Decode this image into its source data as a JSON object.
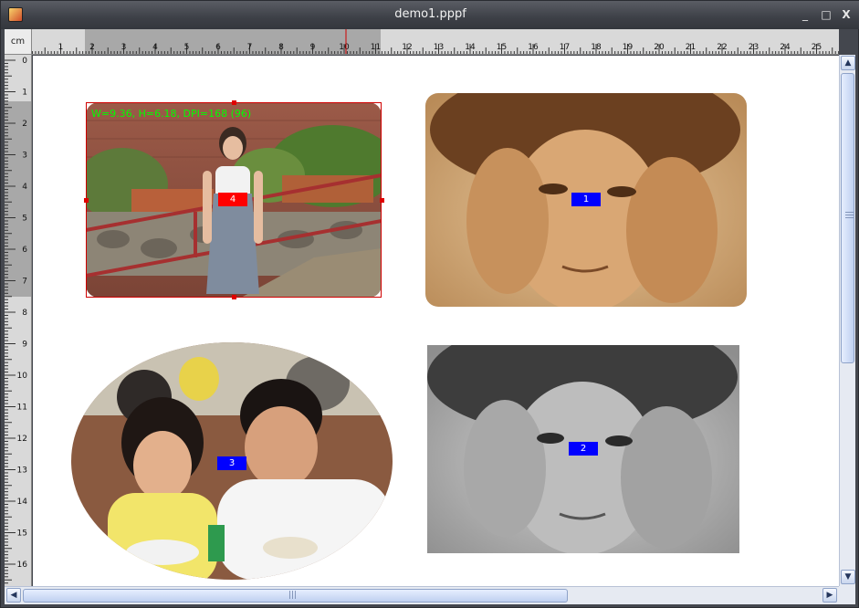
{
  "window": {
    "title": "demo1.pppf",
    "buttons": {
      "minimize": "_",
      "maximize": "□",
      "close": "X"
    }
  },
  "ruler": {
    "unit": "cm",
    "horizontal_labels": [
      "1",
      "2",
      "3",
      "4",
      "5",
      "6",
      "7",
      "8",
      "9",
      "10",
      "11",
      "12",
      "13",
      "14",
      "15",
      "16",
      "17",
      "18",
      "19",
      "20",
      "21",
      "22",
      "23",
      "24",
      "25"
    ],
    "vertical_labels": [
      "0",
      "1",
      "2",
      "3",
      "4",
      "5",
      "6",
      "7",
      "8",
      "9",
      "10",
      "11",
      "12",
      "13",
      "14",
      "15",
      "16"
    ]
  },
  "photos": [
    {
      "id": "photo-1",
      "number": "1",
      "tag_color": "#0000ff",
      "shape": "rounded-rectangle",
      "tone": "sepia",
      "subject": "child-with-hands-on-ears"
    },
    {
      "id": "photo-2",
      "number": "2",
      "tag_color": "#0000ff",
      "shape": "rectangle",
      "tone": "grayscale",
      "subject": "child-with-hands-on-ears"
    },
    {
      "id": "photo-3",
      "number": "3",
      "tag_color": "#0000ff",
      "shape": "ellipse",
      "tone": "color",
      "subject": "couple-eating"
    },
    {
      "id": "photo-4",
      "number": "4",
      "tag_color": "#ff0000",
      "shape": "rounded-rectangle",
      "tone": "color",
      "subject": "woman-standing-by-railing",
      "selected": true,
      "info": "W=9.36, H=6.18, DPI=168 (96)"
    }
  ],
  "scrollbar": {
    "grip": "|||"
  }
}
